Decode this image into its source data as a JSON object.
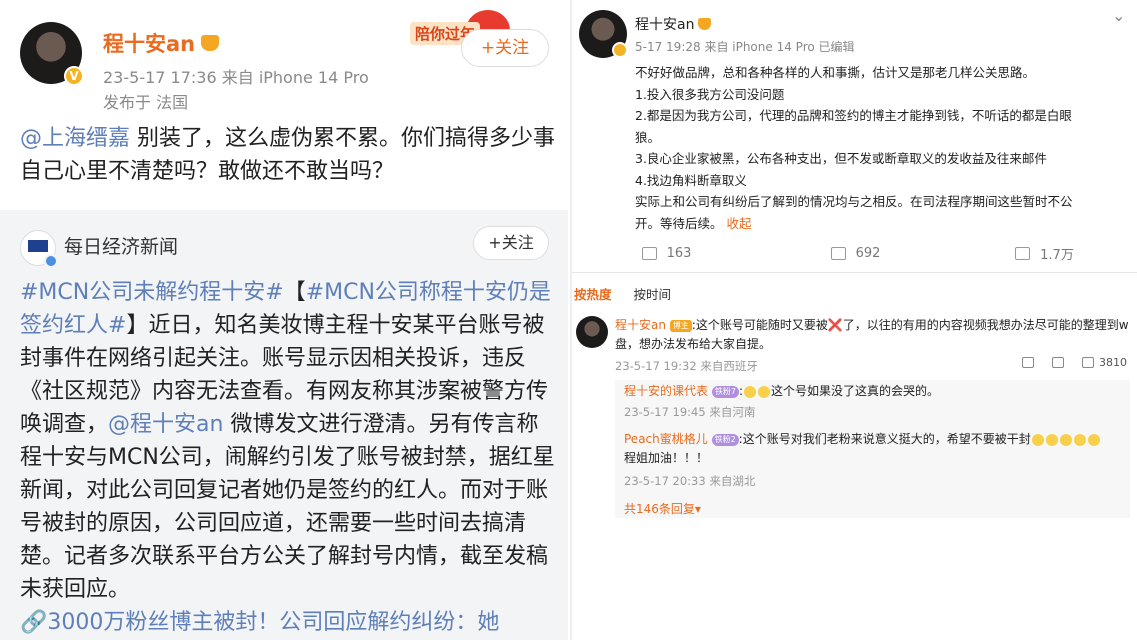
{
  "left": {
    "author": "程十安an",
    "time_source": "23-5-17 17:36  来自 iPhone 14 Pro",
    "location": "发布于 法国",
    "banner_text": "陪你过年",
    "follow_label": "+关注",
    "mention": "@上海缙嘉",
    "content": " 别装了，这么虚伪累不累。你们搞得多少事自己心里不清楚吗？敢做还不敢当吗？",
    "repost": {
      "source": "每日经济新闻",
      "follow_label": "+关注",
      "tag1": "#MCN公司未解约程十安#",
      "bracket_open": "【",
      "tag2": "#MCN公司称程十安仍是签约红人#",
      "text1": "】近日，知名美妆博主程十安某平台账号被封事件在网络引起关注。账号显示因相关投诉，违反《社区规范》内容无法查看。有网友称其涉案被警方传唤调查，",
      "mention": "@程十安an",
      "text2": " 微博发文进行澄清。另有传言称程十安与MCN公司，闹解约引发了账号被封禁，据红星新闻，对此公司回复记者她仍是签约的红人。而对于账号被封的原因，公司回应道，还需要一些时间去搞清楚。记者多次联系平台方公关了解封号内情，截至发稿未获回应。",
      "link": "🔗3000万粉丝博主被封！公司回应解约纠纷：她"
    }
  },
  "right": {
    "author": "程十安an",
    "meta": "5-17 19:28 来自 iPhone 14 Pro 已编辑",
    "body_lines": [
      "不好好做品牌，总和各种各样的人和事撕，估计又是那老几样公关思路。",
      "1.投入很多我方公司没问题",
      "2.都是因为我方公司，代理的品牌和签约的博主才能挣到钱，不听话的都是白眼狼。",
      "3.良心企业家被黑，公布各种支出，但不发或断章取义的发收益及往来邮件",
      "4.找边角料断章取义",
      "实际上和公司有纠纷后了解到的情况均与之相反。在司法程序期间这些暂时不公开。等待后续。"
    ],
    "collapse": "收起",
    "repost_count": "163",
    "comment_count": "692",
    "like_count": "1.7万",
    "tab_hot": "按热度",
    "tab_time": "按时间",
    "comment": {
      "author": "程十安an",
      "badge": "博主",
      "text_a": ":这个账号可能随时又要被",
      "cross": "❌",
      "text_b": "了，以往的有用的内容视频我想办法尽可能的整理到w盘，想办法发布给大家自提。",
      "meta": "23-5-17 19:32 来自西班牙",
      "like_count": "3810"
    },
    "replies": [
      {
        "author": "程十安的课代表",
        "badge": "铁粉7",
        "text": ":",
        "text2": "这个号如果没了这真的会哭的。",
        "meta": "23-5-17 19:45 来自河南"
      },
      {
        "author": "Peach蜜桃格儿",
        "badge": "铁粉2",
        "text": ":这个账号对我们老粉来说意义挺大的，希望不要被干封",
        "text2": "程姐加油！！！",
        "meta": "23-5-17 20:33 来自湖北"
      }
    ],
    "more_replies": "共146条回复▾"
  }
}
